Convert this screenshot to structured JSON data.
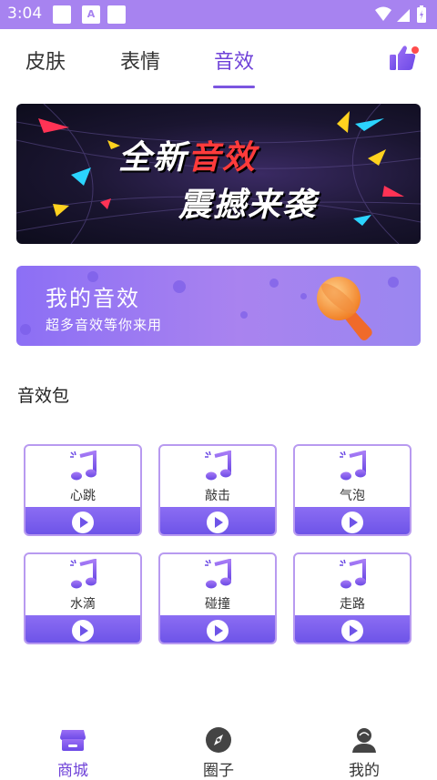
{
  "status_bar": {
    "time": "3:04",
    "notif_letter": "A"
  },
  "tabs": [
    {
      "label": "皮肤"
    },
    {
      "label": "表情"
    },
    {
      "label": "音效",
      "active": true
    }
  ],
  "banner": {
    "line1_a": "全新",
    "line1_b": "音效",
    "line2": "震撼来袭"
  },
  "promo": {
    "title": "我的音效",
    "subtitle": "超多音效等你来用"
  },
  "section": {
    "title": "音效包"
  },
  "sound_packs": [
    {
      "label": "心跳",
      "icon": "music-note-icon"
    },
    {
      "label": "敲击",
      "icon": "music-note-icon"
    },
    {
      "label": "气泡",
      "icon": "music-note-icon"
    },
    {
      "label": "水滴",
      "icon": "music-note-icon"
    },
    {
      "label": "碰撞",
      "icon": "music-note-icon"
    },
    {
      "label": "走路",
      "icon": "music-note-icon"
    }
  ],
  "bottom_nav": [
    {
      "label": "商城",
      "icon": "store-icon",
      "active": true
    },
    {
      "label": "圈子",
      "icon": "compass-icon"
    },
    {
      "label": "我的",
      "icon": "user-icon"
    }
  ],
  "colors": {
    "accent": "#6f42d8",
    "status_bar": "#a783f0",
    "card_border": "#b89af0",
    "card_bottom": "#6e54e8"
  }
}
